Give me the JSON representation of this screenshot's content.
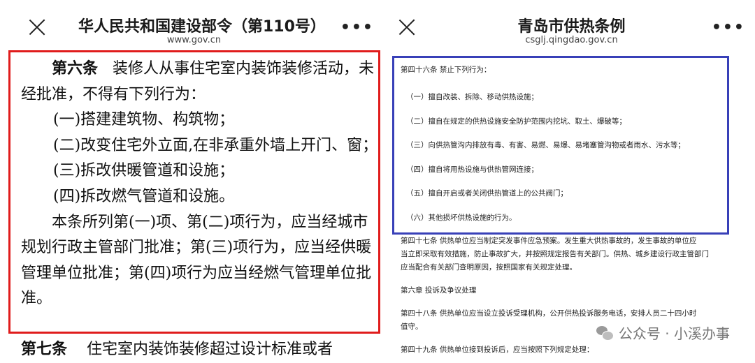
{
  "left": {
    "header": {
      "title": "华人民共和国建设部令（第110号）",
      "subtitle": "www.gov.cn"
    },
    "article6_heading": "第六条",
    "article6_intro": "装修人从事住宅室内装饰装修活动，未经批准，不得有下列行为：",
    "items": [
      "(一)搭建建筑物、构筑物；",
      "(二)改变住宅外立面,在非承重外墙上开门、窗；",
      "(三)拆改供暖管道和设施；",
      "(四)拆改燃气管道和设施。"
    ],
    "article6_tail": "本条所列第(一)项、第(二)项行为，应当经城市规划行政主管部门批准；第(三)项行为，应当经供暖管理单位批准；第(四)项行为应当经燃气管理单位批准。",
    "article7_heading": "第七条",
    "article7_text": "住宅室内装饰装修超过设计标准或者"
  },
  "right": {
    "header": {
      "title": "青岛市供热条例",
      "subtitle": "csglj.qingdao.gov.cn"
    },
    "article46_heading": "第四十六条 禁止下列行为：",
    "items": [
      "（一）擅自改装、拆除、移动供热设施；",
      "（二）擅自在规定的供热设施安全防护范围内挖坑、取土、爆破等；",
      "（三）向供热管沟内排放有毒、有害、易燃、易爆、易堵塞管沟物或者雨水、污水等；",
      "（四）擅自将用热设施与供热管网连接；",
      "（五）擅自开启或者关闭供热管道上的公共阀门；",
      "（六）其他损坏供热设施的行为。"
    ],
    "article47": [
      "第四十七条 供热单位应当制定突发事件应急预案。发生重大供热事故的，发生事故的单位应",
      "当立即采取有效措施，防止事故扩大，并按照规定报告有关部门。供热、城乡建设行政主管部门",
      "应当配合有关部门查明原因，按照国家有关规定处理。"
    ],
    "chapter6": "第六章  投诉及争议处理",
    "article48": [
      "第四十八条 供热单位应当设立投诉受理机构，公开供热投诉服务电话，安排人员二十四小时",
      "值守。"
    ],
    "article49": "第四十九条 供热单位接到投诉后，应当按照下列规定处理："
  },
  "watermark": "公众号 · 小溪办事",
  "colors": {
    "red_box": "#e01c1c",
    "blue_box": "#3840b8"
  }
}
